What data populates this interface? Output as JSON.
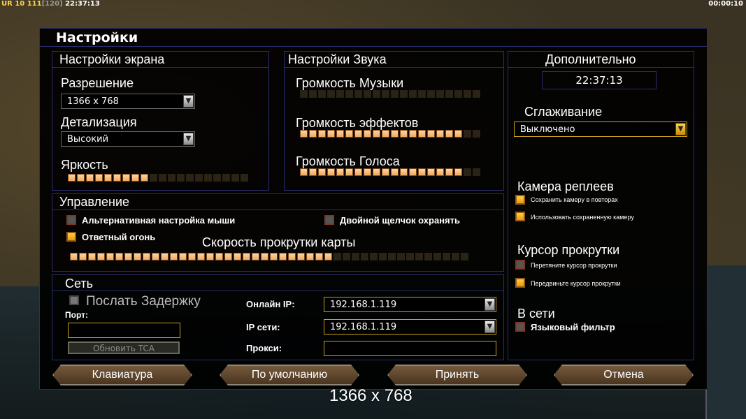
{
  "hud": {
    "left_prefix": "UR",
    "left_a": "10",
    "left_b": "111",
    "left_c": "[120]",
    "left_time": "22:37:13",
    "right_time": "00:00:10"
  },
  "dialog": {
    "title": "Настройки",
    "screen": {
      "header": "Настройки экрана",
      "resolution_label": "Разрешение",
      "resolution_value": "1366 x 768",
      "detail_label": "Детализация",
      "detail_value": "Высокий",
      "brightness_label": "Яркость",
      "brightness_level": 0.46
    },
    "sound": {
      "header": "Настройки Звука",
      "music_label": "Громкость Музыки",
      "music_level": 0.0,
      "effects_label": "Громкость эффектов",
      "effects_level": 0.88,
      "voice_label": "Громкость Голоса",
      "voice_level": 0.88
    },
    "extra": {
      "header": "Дополнительно",
      "clock": "22:37:13",
      "aa_label": "Сглаживание",
      "aa_value": "Выключено",
      "replay_header": "Камера реплеев",
      "replay_opt1": "Сохранить камеру в повторах",
      "replay_opt2": "Использовать сохраненную камеру",
      "scroll_header": "Курсор прокрутки",
      "scroll_opt1": "Перетяните курсор прокрутки",
      "scroll_opt2": "Передвиньте курсор прокрутки",
      "online_header": "В сети",
      "lang_filter": "Языковый фильтр"
    },
    "control": {
      "header": "Управление",
      "alt_mouse": "Альтернативная настройка мыши",
      "double_click": "Двойной щелчок охранять",
      "return_fire": "Ответный огонь",
      "scroll_speed_label": "Скорость прокрутки карты",
      "scroll_speed_level": 0.66
    },
    "network": {
      "header": "Сеть",
      "send_delay": "Послать Задержку",
      "port_label": "Порт:",
      "port_value": "",
      "refresh_tca": "Обновить TCA",
      "online_ip_label": "Онлайн IP:",
      "online_ip_value": "192.168.1.119",
      "lan_ip_label": "IP сети:",
      "lan_ip_value": "192.168.1.119",
      "proxy_label": "Прокси:",
      "proxy_value": ""
    },
    "buttons": {
      "keyboard": "Клавиатура",
      "defaults": "По умолчанию",
      "accept": "Принять",
      "cancel": "Отмена"
    }
  },
  "res_caption": "1366 x 768",
  "colors": {
    "accent": "#f0a860",
    "border": "#2b2d6e",
    "gold": "#c9a21b"
  }
}
